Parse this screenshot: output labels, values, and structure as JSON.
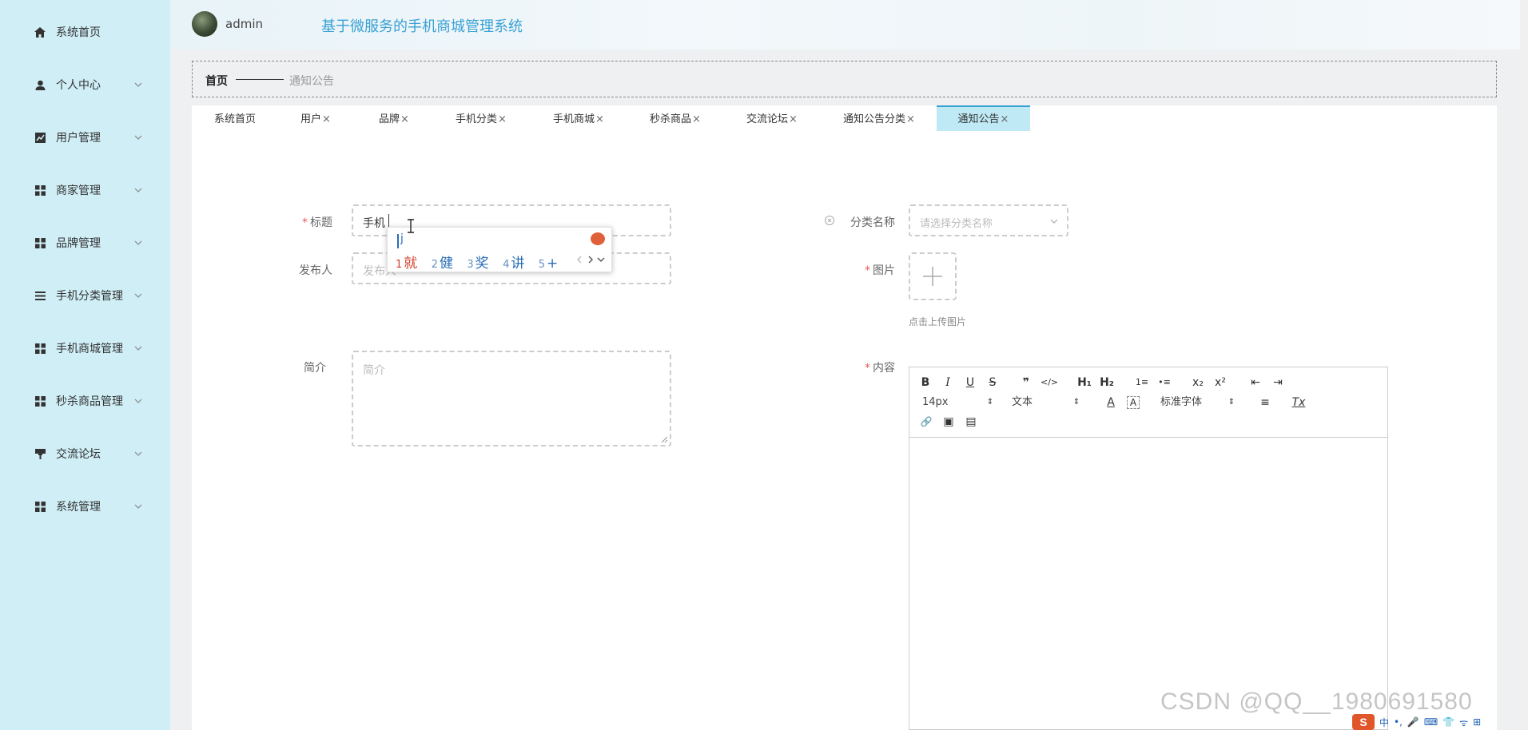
{
  "header": {
    "username": "admin",
    "system_title": "基于微服务的手机商城管理系统"
  },
  "sidebar": {
    "items": [
      {
        "label": "系统首页",
        "icon": "home-icon",
        "has_children": false
      },
      {
        "label": "个人中心",
        "icon": "user-icon",
        "has_children": true
      },
      {
        "label": "用户管理",
        "icon": "chart-icon",
        "has_children": true
      },
      {
        "label": "商家管理",
        "icon": "grid-icon",
        "has_children": true
      },
      {
        "label": "品牌管理",
        "icon": "grid-icon",
        "has_children": true
      },
      {
        "label": "手机分类管理",
        "icon": "list-icon",
        "has_children": true
      },
      {
        "label": "手机商城管理",
        "icon": "grid-icon",
        "has_children": true
      },
      {
        "label": "秒杀商品管理",
        "icon": "grid-icon",
        "has_children": true
      },
      {
        "label": "交流论坛",
        "icon": "brush-icon",
        "has_children": true
      },
      {
        "label": "系统管理",
        "icon": "grid-icon",
        "has_children": true
      }
    ]
  },
  "breadcrumb": {
    "home": "首页",
    "current": "通知公告"
  },
  "tabs": [
    {
      "label": "系统首页",
      "closable": false,
      "active": false
    },
    {
      "label": "用户",
      "closable": true,
      "active": false
    },
    {
      "label": "品牌",
      "closable": true,
      "active": false
    },
    {
      "label": "手机分类",
      "closable": true,
      "active": false
    },
    {
      "label": "手机商城",
      "closable": true,
      "active": false
    },
    {
      "label": "秒杀商品",
      "closable": true,
      "active": false
    },
    {
      "label": "交流论坛",
      "closable": true,
      "active": false
    },
    {
      "label": "通知公告分类",
      "closable": true,
      "active": false
    },
    {
      "label": "通知公告",
      "closable": true,
      "active": true
    }
  ],
  "close_glyph": "×",
  "form": {
    "title": {
      "label": "标题",
      "required": true,
      "value": "手机"
    },
    "publisher": {
      "label": "发布人",
      "required": false,
      "placeholder": "发布人"
    },
    "intro": {
      "label": "简介",
      "required": false,
      "placeholder": "简介"
    },
    "category": {
      "label": "分类名称",
      "required": false,
      "placeholder": "请选择分类名称"
    },
    "image": {
      "label": "图片",
      "required": true,
      "upload_tip": "点击上传图片"
    },
    "content": {
      "label": "内容",
      "required": true
    }
  },
  "required_mark": "*",
  "ime": {
    "typed": "j",
    "candidates": [
      {
        "num": "1",
        "text": "就"
      },
      {
        "num": "2",
        "text": "健"
      },
      {
        "num": "3",
        "text": "奖"
      },
      {
        "num": "4",
        "text": "讲"
      },
      {
        "num": "5",
        "text": "+"
      }
    ]
  },
  "editor": {
    "font_size": "14px",
    "header_select": "文本",
    "font_family": "标准字体",
    "buttons": {
      "bold": "B",
      "italic": "I",
      "underline": "U",
      "strike": "S",
      "quote": "❞",
      "code": "</>",
      "h1": "H₁",
      "h2": "H₂",
      "ol": "1≡",
      "ul": "•≡",
      "sub": "x₂",
      "sup": "x²",
      "outdent": "⇤",
      "indent": "⇥",
      "color": "A",
      "bg": "A",
      "align": "≡",
      "clean": "Tx",
      "link": "🔗",
      "image": "▣",
      "video": "▤"
    }
  },
  "watermark": "CSDN @QQ__1980691580",
  "tray": {
    "items": [
      "中",
      "•,",
      "🎤",
      "⌨",
      "👕",
      "ᯤ",
      "⊞"
    ]
  }
}
